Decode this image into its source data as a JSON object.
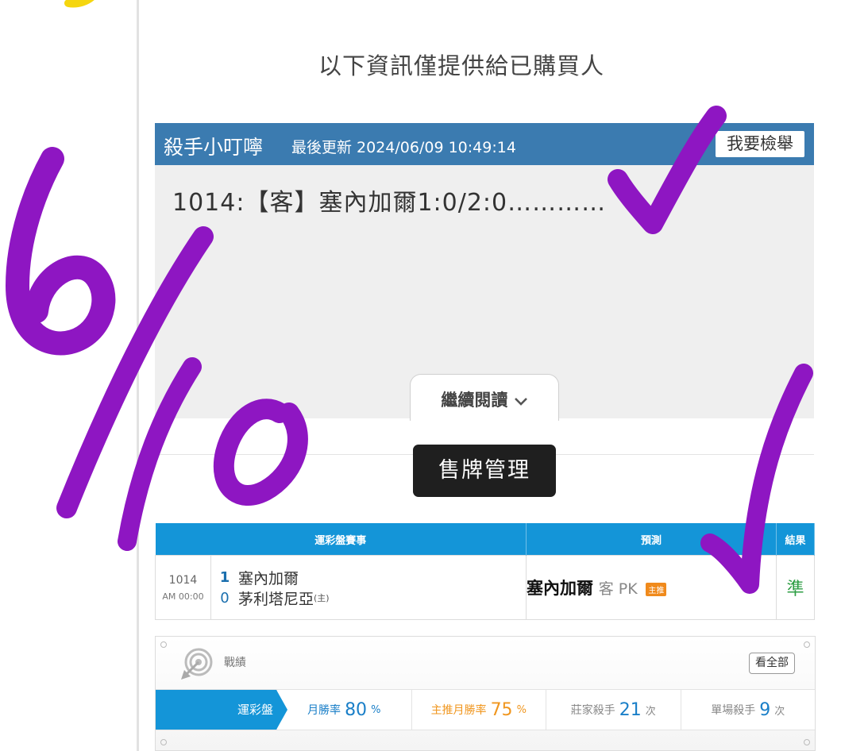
{
  "notice": "以下資訊僅提供給已購買人",
  "article": {
    "author": "殺手小叮嚀",
    "updated": "最後更新 2024/06/09 10:49:14",
    "report_label": "我要檢舉",
    "headline": "1014:【客】塞內加爾1:0/2:0…………",
    "read_more": "繼續閱讀"
  },
  "sale_button": "售牌管理",
  "game_table": {
    "headers": [
      "運彩盤賽事",
      "預測",
      "結果"
    ],
    "row": {
      "code": "1014",
      "time": "AM 00:00",
      "team1_score": "1",
      "team1_name": "塞內加爾",
      "team2_score": "0",
      "team2_name": "茅利塔尼亞",
      "home_tag": "(主)",
      "prediction_team": "塞內加爾",
      "prediction_side": "客 PK",
      "prediction_tag": "主推",
      "result": "準"
    }
  },
  "record": {
    "title": "戰績",
    "view_all": "看全部",
    "tab": "運彩盤",
    "stats": [
      {
        "label": "月勝率",
        "value": "80",
        "unit": "%"
      },
      {
        "label": "主推月勝率",
        "value": "75",
        "unit": "%"
      },
      {
        "label": "莊家殺手",
        "value": "21",
        "unit": "次"
      },
      {
        "label": "單場殺手",
        "value": "9",
        "unit": "次"
      }
    ]
  },
  "colors": {
    "header_blue": "#3b7bb0",
    "table_blue": "#1495d8",
    "result_green": "#2e9e44",
    "accent_orange": "#f0961e",
    "annotation_purple": "#8e16c2",
    "annotation_yellow": "#f5d60f"
  }
}
